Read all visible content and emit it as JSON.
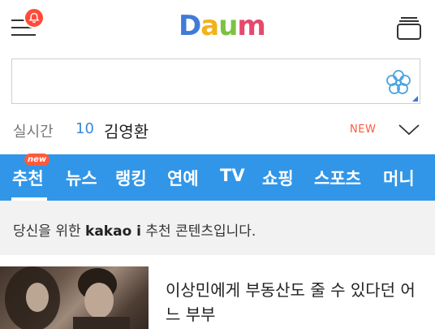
{
  "header": {
    "logo_text": "Daum",
    "logo_colors": [
      "#3f7cd6",
      "#f2b21b",
      "#7dc242",
      "#e7486b"
    ],
    "menu_icon": "hamburger-menu-icon",
    "alert_icon": "bell-icon",
    "tabs_icon": "browser-tabs-icon"
  },
  "search": {
    "value": "",
    "placeholder": "",
    "flower_icon": "daum-flower-icon",
    "flower_color": "#4aa3df"
  },
  "realtime": {
    "label": "실시간",
    "rank": "10",
    "keyword": "김영환",
    "status": "NEW"
  },
  "nav": {
    "background": "#3196e8",
    "new_badge": "new",
    "items": [
      "추천",
      "뉴스",
      "랭킹",
      "연예",
      "TV",
      "쇼핑",
      "스포츠",
      "머니"
    ]
  },
  "kakao": {
    "prefix": "당신을 위한",
    "brand": "kakao i",
    "suffix": "추천 콘텐츠입니다."
  },
  "article": {
    "title": "이상민에게 부동산도 줄 수 있다던 어느 부부"
  }
}
